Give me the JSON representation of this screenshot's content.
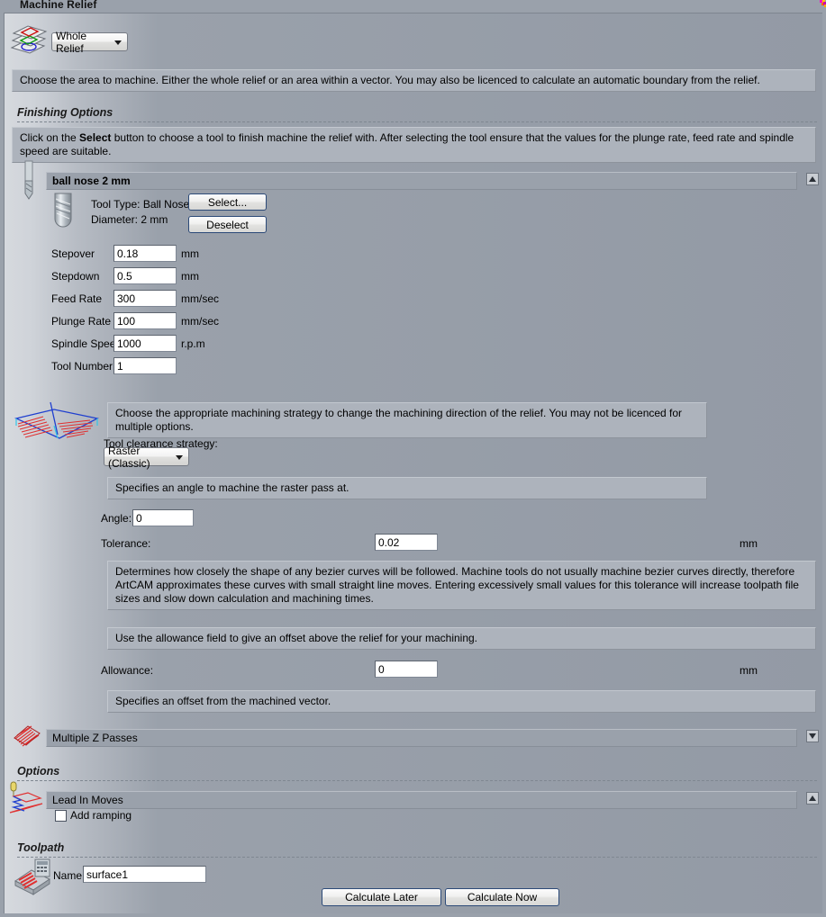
{
  "window": {
    "title": "Machine Relief"
  },
  "area": {
    "icon": "layers-icon",
    "selected": "Whole Relief",
    "options": [
      "Whole Relief"
    ],
    "description": "Choose the area to machine. Either the whole relief or an area within a vector. You may also be licenced to calculate an automatic boundary from the relief."
  },
  "finishing": {
    "section_title": "Finishing Options",
    "description": "Click on the Select button to choose a tool to finish machine the relief with. After selecting the tool ensure that the values for the plunge rate, feed rate and spindle speed are suitable.",
    "description_bold_word": "Select",
    "tool": {
      "name": "ball nose 2 mm",
      "type_label": "Tool Type:",
      "type_value": "Ball Nose",
      "diameter_label": "Diameter:",
      "diameter_value": "2 mm",
      "select_button": "Select...",
      "deselect_button": "Deselect"
    },
    "params": [
      {
        "label": "Stepover",
        "value": "0.18",
        "unit": "mm"
      },
      {
        "label": "Stepdown",
        "value": "0.5",
        "unit": "mm"
      },
      {
        "label": "Feed Rate",
        "value": "300",
        "unit": "mm/sec"
      },
      {
        "label": "Plunge Rate",
        "value": "100",
        "unit": "mm/sec"
      },
      {
        "label": "Spindle Speed",
        "value": "1000",
        "unit": "r.p.m"
      },
      {
        "label": "Tool Number",
        "value": "1",
        "unit": ""
      }
    ]
  },
  "strategy": {
    "description": "Choose the appropriate machining strategy to change the machining direction of the relief. You may not be licenced for multiple options.",
    "label": "Tool clearance strategy:",
    "selected": "Raster (Classic)",
    "options": [
      "Raster (Classic)"
    ],
    "angle_description": "Specifies an angle to machine the raster pass at.",
    "angle_label": "Angle:",
    "angle_value": "0",
    "tolerance_label": "Tolerance:",
    "tolerance_value": "0.02",
    "tolerance_unit": "mm",
    "tolerance_description": "Determines how closely the shape of any bezier curves will be followed. Machine tools do not usually machine bezier curves directly, therefore ArtCAM approximates these curves with small straight line moves. Entering excessively small values for this tolerance will increase toolpath file sizes and slow down calculation and machining times.",
    "allowance_description": "Use the allowance field to give an offset above the relief for your machining.",
    "allowance_label": "Allowance:",
    "allowance_value": "0",
    "allowance_unit": "mm",
    "offset_description": "Specifies an offset from the machined vector."
  },
  "multiple_z": {
    "label": "Multiple Z Passes",
    "icon": "z-passes-icon"
  },
  "options": {
    "section_title": "Options",
    "lead_in": {
      "label": "Lead In Moves",
      "icon": "lead-in-icon"
    },
    "add_ramping": {
      "label": "Add ramping",
      "checked": false
    }
  },
  "toolpath": {
    "section_title": "Toolpath",
    "icon": "toolpath-icon",
    "name_label": "Name:",
    "name_value": "surface1",
    "calculate_later": "Calculate Later",
    "calculate_now": "Calculate Now"
  },
  "colors": {
    "panel_bg": "#9aa1ab",
    "info_bg": "#adb3bc",
    "group_bar": "#9aa1ab",
    "button_border": "#2c4a78",
    "field_bg": "#ffffff"
  }
}
